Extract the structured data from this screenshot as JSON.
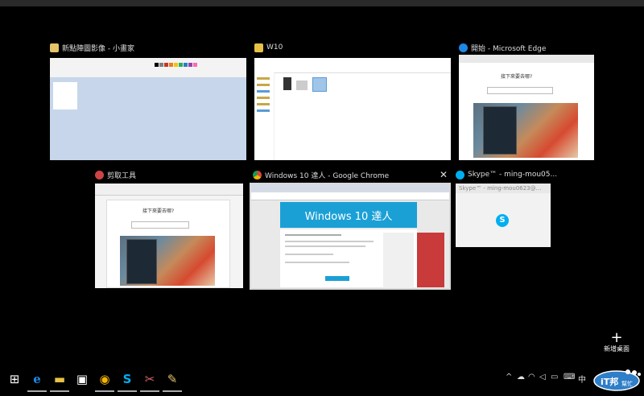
{
  "windows": [
    {
      "title": "新點陣圖影像 - 小畫家",
      "icon": "paint-icon"
    },
    {
      "title": "W10",
      "icon": "folder-icon"
    },
    {
      "title": "開始 - Microsoft Edge",
      "icon": "edge-icon",
      "thumb_text": "接下來要去哪?"
    },
    {
      "title": "剪取工具",
      "icon": "snipping-tool-icon",
      "thumb_text": "接下來要去哪?"
    },
    {
      "title": "Windows 10 達人 - Google Chrome",
      "icon": "chrome-icon",
      "close_label": "✕",
      "thumb_text": "Windows 10 達人"
    },
    {
      "title": "Skype™ - ming-mou05...",
      "icon": "skype-icon",
      "thumb_text": "Skype™ - ming-mou0623@..."
    }
  ],
  "new_desktop": {
    "plus": "+",
    "label": "新增桌面"
  },
  "taskbar": {
    "items": [
      {
        "name": "windows-start-icon",
        "glyph": "⊞"
      },
      {
        "name": "edge-icon",
        "glyph": "e"
      },
      {
        "name": "file-explorer-icon",
        "glyph": "▬"
      },
      {
        "name": "store-icon",
        "glyph": "▣"
      },
      {
        "name": "chrome-icon",
        "glyph": "◉"
      },
      {
        "name": "skype-icon",
        "glyph": "S"
      },
      {
        "name": "snipping-tool-icon",
        "glyph": "✂"
      },
      {
        "name": "paint-icon",
        "glyph": "✎"
      }
    ],
    "tray": {
      "chevron": "^",
      "ime": "中"
    }
  },
  "watermark": {
    "text": "iT邦幫忙"
  }
}
